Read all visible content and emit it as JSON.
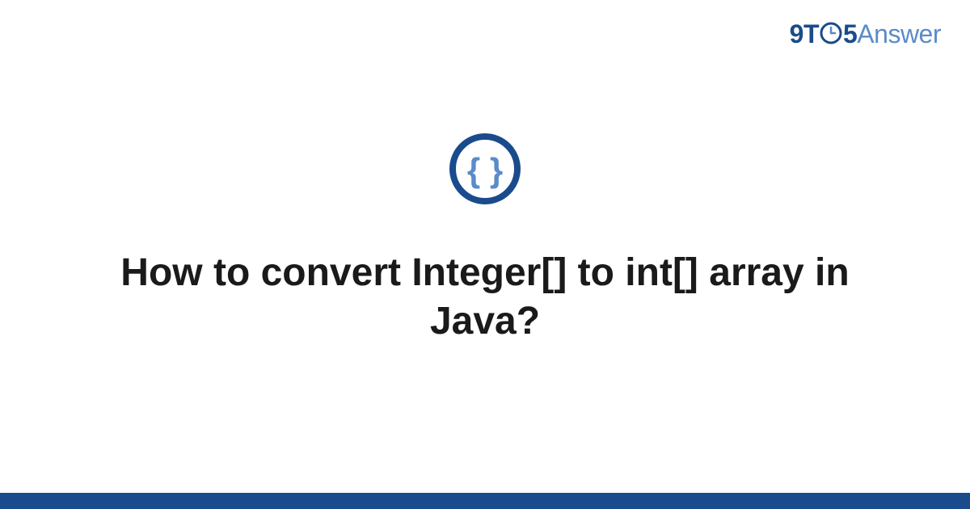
{
  "brand": {
    "part1": "9T",
    "part2": "5",
    "part3": "Answer"
  },
  "topic_icon": "code-braces-icon",
  "title": "How to convert Integer[] to int[] array in Java?",
  "colors": {
    "brand_dark": "#1a4b8c",
    "brand_light": "#5b8bc9",
    "text": "#1a1a1a"
  }
}
